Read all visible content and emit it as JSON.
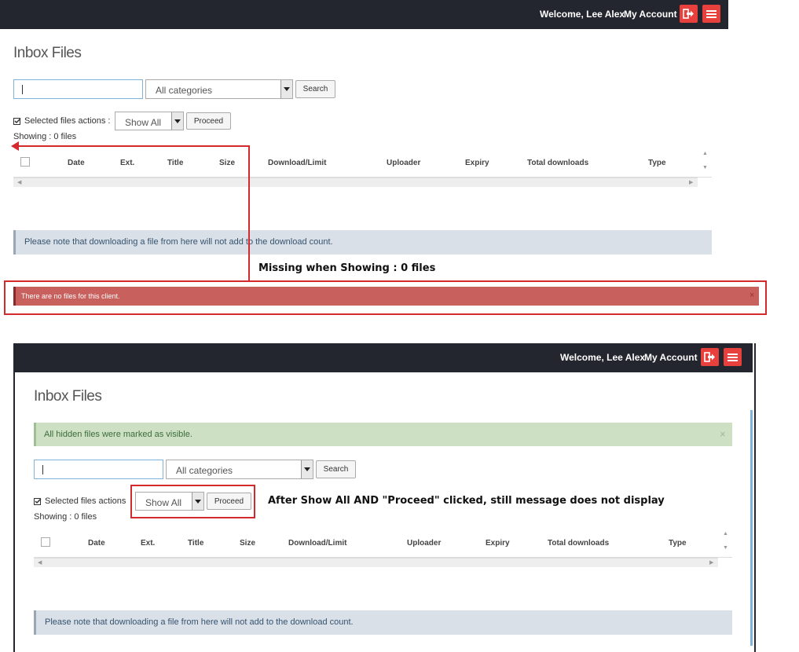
{
  "top": {
    "header": {
      "welcome": "Welcome, Lee Alex",
      "account": "My Account"
    },
    "title": "Inbox Files",
    "search": {
      "placeholder": "",
      "category": "All categories",
      "button": "Search"
    },
    "actions": {
      "label": "Selected files actions :",
      "select": "Show All",
      "proceed": "Proceed"
    },
    "showing": "Showing : 0 files",
    "columns": [
      "Date",
      "Ext.",
      "Title",
      "Size",
      "Download/Limit",
      "Uploader",
      "Expiry",
      "Total downloads",
      "Type"
    ],
    "note": "Please note that downloading a file from here will not add to the download count.",
    "error_alert": "There are no files for this client.",
    "close_symbol": "×"
  },
  "annotations": {
    "missing": "Missing when Showing : 0 files",
    "after": "After Show All AND \"Proceed\" clicked, still message does not display"
  },
  "bottom": {
    "header": {
      "welcome": "Welcome, Lee Alex",
      "account": "My Account"
    },
    "title": "Inbox Files",
    "success_alert": "All hidden files were marked as visible.",
    "close_symbol": "×",
    "search": {
      "placeholder": "",
      "category": "All categories",
      "button": "Search"
    },
    "actions": {
      "label": "Selected files actions",
      "select": "Show All",
      "proceed": "Proceed"
    },
    "showing": "Showing : 0 files",
    "columns": [
      "Date",
      "Ext.",
      "Title",
      "Size",
      "Download/Limit",
      "Uploader",
      "Expiry",
      "Total downloads",
      "Type"
    ],
    "note": "Please note that downloading a file from here will not add to the download count."
  },
  "colors": {
    "header_bg": "#23262e",
    "accent_red": "#e8413d",
    "annotation_red": "#d42a2e",
    "error_bg": "#c8605d",
    "success_bg": "#cde0c4",
    "note_bg": "#d9e0e8"
  },
  "icons": {
    "logout": "sign-out-icon",
    "menu": "hamburger-menu-icon",
    "checkbox": "check-square-icon"
  }
}
